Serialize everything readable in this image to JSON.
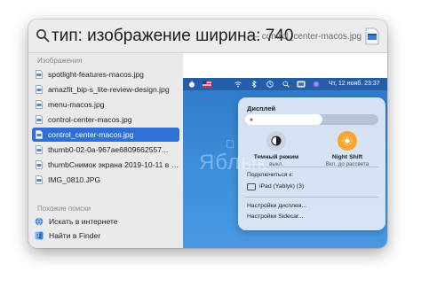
{
  "search": {
    "query": "тип: изображение ширина: 740",
    "completion": "— control_center-macos.jpg",
    "top_icon": "image-file-icon"
  },
  "results": {
    "images_header": "Изображения",
    "items": [
      {
        "label": "spotlight-features-macos.jpg",
        "selected": false
      },
      {
        "label": "amazfit_bip-s_lite-review-design.jpg",
        "selected": false
      },
      {
        "label": "menu-macos.jpg",
        "selected": false
      },
      {
        "label": "control-center-macos.jpg",
        "selected": false
      },
      {
        "label": "control_center-macos.jpg",
        "selected": true
      },
      {
        "label": "thumb0-02-0a-967ae6809662557...",
        "selected": false
      },
      {
        "label": "thumbСнимок экрана 2019-10-11 в 17...",
        "selected": false
      },
      {
        "label": "IMG_0810.JPG",
        "selected": false
      }
    ],
    "searches_header": "Похожие поиски",
    "searches": [
      {
        "label": "Искать в интернете",
        "icon": "globe-icon"
      },
      {
        "label": "Найти в Finder",
        "icon": "finder-icon"
      }
    ]
  },
  "preview": {
    "menubar_date": "Чт, 12 нояб. 23:37",
    "control_center": {
      "display_title": "Дисплей",
      "brightness_fraction": 0.58,
      "dark_mode_title": "Темный режим",
      "dark_mode_status": "выкл.",
      "night_shift_title": "Night Shift",
      "night_shift_status": "Вкл. до рассвета",
      "connect_to_label": "Подключиться к:",
      "device_name": "iPad (Yablyk) (3)",
      "display_settings": "Настройки дисплея...",
      "sidecar_settings": "Настройки Sidecar..."
    },
    "watermark": "Яблык"
  },
  "colors": {
    "selection": "#2f6fd6",
    "desktop": "#3d8fdc",
    "night_shift": "#ffa42b"
  }
}
